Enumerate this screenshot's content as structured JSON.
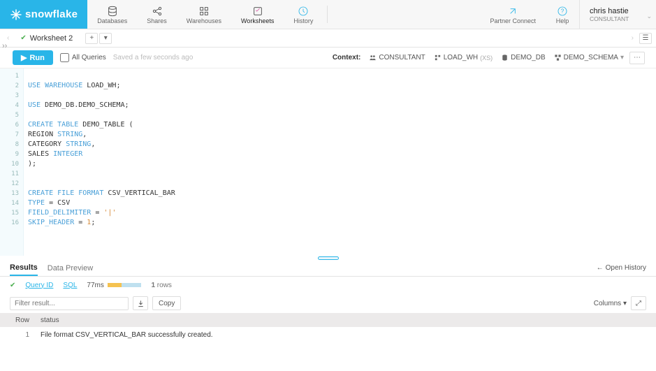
{
  "brand": "snowflake",
  "nav": [
    {
      "label": "Databases",
      "icon": "database-icon"
    },
    {
      "label": "Shares",
      "icon": "share-icon"
    },
    {
      "label": "Warehouses",
      "icon": "warehouse-icon"
    },
    {
      "label": "Worksheets",
      "icon": "worksheet-icon",
      "active": true
    },
    {
      "label": "History",
      "icon": "history-icon"
    }
  ],
  "topright": {
    "partner": "Partner Connect",
    "help": "Help"
  },
  "user": {
    "name": "chris hastie",
    "role": "CONSULTANT"
  },
  "worksheet": {
    "name": "Worksheet 2"
  },
  "toolbar": {
    "run": "Run",
    "all_queries": "All Queries",
    "saved": "Saved a few seconds ago"
  },
  "context": {
    "label": "Context:",
    "role": "CONSULTANT",
    "warehouse": "LOAD_WH",
    "wh_size": "(XS)",
    "database": "DEMO_DB",
    "schema": "DEMO_SCHEMA"
  },
  "sql_lines": [
    "",
    "USE WAREHOUSE LOAD_WH;",
    "",
    "USE DEMO_DB.DEMO_SCHEMA;",
    "",
    "CREATE TABLE DEMO_TABLE (",
    "    REGION STRING,",
    "    CATEGORY STRING,",
    "    SALES INTEGER",
    ");",
    "",
    "",
    "CREATE FILE FORMAT CSV_VERTICAL_BAR",
    "    TYPE = CSV",
    "    FIELD_DELIMITER = '|'",
    "    SKIP_HEADER = 1;"
  ],
  "results": {
    "tabs": {
      "results": "Results",
      "preview": "Data Preview"
    },
    "open_history": "Open History",
    "query_id": "Query ID",
    "sql_link": "SQL",
    "duration": "77ms",
    "row_count": "1",
    "row_count_label": "rows",
    "filter_placeholder": "Filter result...",
    "copy": "Copy",
    "columns": "Columns",
    "headers": {
      "row": "Row",
      "status": "status"
    },
    "rows": [
      {
        "n": "1",
        "status": "File format CSV_VERTICAL_BAR successfully created."
      }
    ]
  }
}
